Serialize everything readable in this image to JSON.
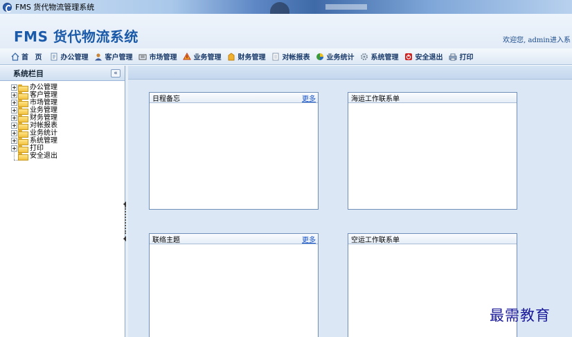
{
  "window": {
    "title": "FMS 货代物流管理系统"
  },
  "header": {
    "app_title": "FMS 货代物流系统",
    "welcome": "欢迎您, admin进入系"
  },
  "toolbar": {
    "items": [
      {
        "label": "首 页",
        "icon": "home-icon"
      },
      {
        "label": "办公管理",
        "icon": "office-icon"
      },
      {
        "label": "客户管理",
        "icon": "user-icon"
      },
      {
        "label": "市场管理",
        "icon": "market-icon"
      },
      {
        "label": "业务管理",
        "icon": "business-icon"
      },
      {
        "label": "财务管理",
        "icon": "finance-icon"
      },
      {
        "label": "对帐报表",
        "icon": "report-icon"
      },
      {
        "label": "业务统计",
        "icon": "stats-icon"
      },
      {
        "label": "系统管理",
        "icon": "gear-icon"
      },
      {
        "label": "安全退出",
        "icon": "exit-icon"
      },
      {
        "label": "打印",
        "icon": "printer-icon"
      }
    ]
  },
  "sidebar": {
    "title": "系统栏目",
    "collapse": "«",
    "items": [
      {
        "label": "办公管理"
      },
      {
        "label": "客户管理"
      },
      {
        "label": "市场管理"
      },
      {
        "label": "业务管理"
      },
      {
        "label": "财务管理"
      },
      {
        "label": "对帐报表"
      },
      {
        "label": "业务统计"
      },
      {
        "label": "系统管理"
      },
      {
        "label": "打印"
      },
      {
        "label": "安全退出"
      }
    ]
  },
  "panels": [
    {
      "title": "日程备忘",
      "more": "更多"
    },
    {
      "title": "海运工作联系单",
      "more": ""
    },
    {
      "title": "联络主题",
      "more": "更多"
    },
    {
      "title": "空运工作联系单",
      "more": ""
    }
  ],
  "watermark": "最需教育",
  "colors": {
    "accent": "#1a5aa8",
    "link": "#1a55c8",
    "content_bg": "#dbe7f5"
  }
}
